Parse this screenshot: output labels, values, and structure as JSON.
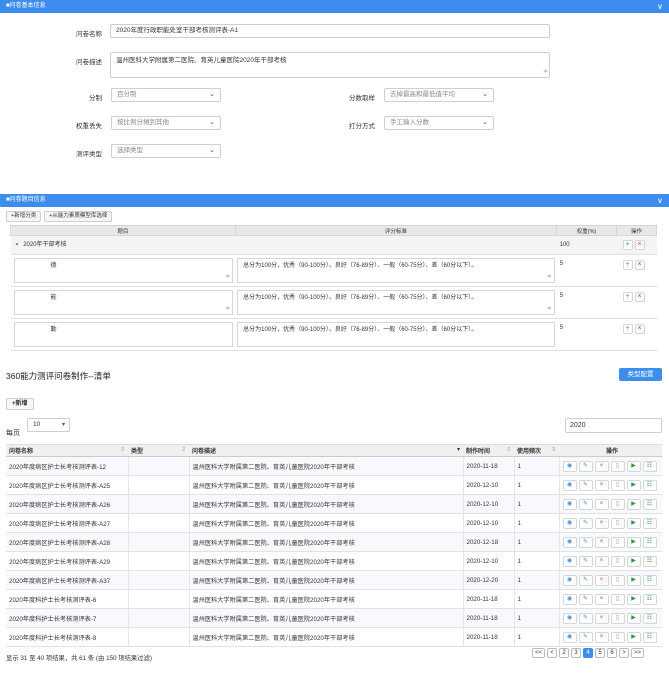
{
  "basic": {
    "header": "■问卷基本信息",
    "name_label": "问卷名称",
    "name_value": "2020年度行政职能处室干部考核测评表-A1",
    "desc_label": "问卷描述",
    "desc_value": "温州医科大学附属第二医院、育英儿童医院2020年干部考核",
    "scale_label": "分制",
    "scale_value": "百分制",
    "score_pick_label": "分数取样",
    "score_pick_value": "去掉最高和最低值平均",
    "weight_lost_label": "权重丢失",
    "weight_lost_value": "按比例分摊到其他",
    "scoring_label": "打分方式",
    "scoring_value": "手工输入分数",
    "type_label": "测评类型",
    "type_value": "选择类型"
  },
  "questions": {
    "header": "■问卷题目信息",
    "add_category": "+新增分类",
    "add_from_model": "+从能力素质模型库选择",
    "col_item": "题目",
    "col_criteria": "评分标准",
    "col_weight": "权重(%)",
    "col_ops": "操作",
    "group": {
      "name": "2020年干部考核",
      "weight": "100"
    },
    "rows": [
      {
        "item": "德",
        "criteria": "总分为100分，优秀（90-100分）、良好（76-89分）、一般（60-75分）、差（60分以下）。",
        "weight": "5"
      },
      {
        "item": "能",
        "criteria": "总分为100分，优秀（90-100分）、良好（76-89分）、一般（60-75分）、差（60分以下）。",
        "weight": "5"
      },
      {
        "item": "勤",
        "criteria": "总分为100分，优秀（90-100分）、良好（76-89分）、一般（60-75分）、差（60分以下）。",
        "weight": "5"
      }
    ]
  },
  "list": {
    "title": "360能力测评问卷制作--清单",
    "config_button": "类型配置",
    "add_button": "+新增",
    "per_page_value": "10",
    "per_page_label": "每页",
    "search_value": "2020",
    "columns": [
      "问卷名称",
      "类型",
      "问卷描述",
      "制作时间",
      "使用频次",
      "操作"
    ],
    "rows": [
      {
        "name": "2020年度病区护士长考核测评表-12",
        "type": "",
        "desc": "温州医科大学附属第二医院、育英儿童医院2020年干部考核",
        "date": "2020-11-18",
        "freq": "1"
      },
      {
        "name": "2020年度病区护士长考核测评表-A25",
        "type": "",
        "desc": "温州医科大学附属第二医院、育英儿童医院2020年干部考核",
        "date": "2020-12-10",
        "freq": "1"
      },
      {
        "name": "2020年度病区护士长考核测评表-A26",
        "type": "",
        "desc": "温州医科大学附属第二医院、育英儿童医院2020年干部考核",
        "date": "2020-12-10",
        "freq": "1"
      },
      {
        "name": "2020年度病区护士长考核测评表-A27",
        "type": "",
        "desc": "温州医科大学附属第二医院、育英儿童医院2020年干部考核",
        "date": "2020-12-10",
        "freq": "1"
      },
      {
        "name": "2020年度病区护士长考核测评表-A28",
        "type": "",
        "desc": "温州医科大学附属第二医院、育英儿童医院2020年干部考核",
        "date": "2020-12-18",
        "freq": "1"
      },
      {
        "name": "2020年度病区护士长考核测评表-A29",
        "type": "",
        "desc": "温州医科大学附属第二医院、育英儿童医院2020年干部考核",
        "date": "2020-12-10",
        "freq": "1"
      },
      {
        "name": "2020年度病区护士长考核测评表-A37",
        "type": "",
        "desc": "温州医科大学附属第二医院、育英儿童医院2020年干部考核",
        "date": "2020-12-20",
        "freq": "1"
      },
      {
        "name": "2020年度科护士长考核测评表-6",
        "type": "",
        "desc": "温州医科大学附属第二医院、育英儿童医院2020年干部考核",
        "date": "2020-11-18",
        "freq": "1"
      },
      {
        "name": "2020年度科护士长考核测评表-7",
        "type": "",
        "desc": "温州医科大学附属第二医院、育英儿童医院2020年干部考核",
        "date": "2020-11-18",
        "freq": "1"
      },
      {
        "name": "2020年度科护士长考核测评表-8",
        "type": "",
        "desc": "温州医科大学附属第二医院、育英儿童医院2020年干部考核",
        "date": "2020-11-18",
        "freq": "1"
      }
    ],
    "footer": "显示 31 至 40 项结果，共 61 条 (由 150 项结果过滤)",
    "pager": [
      "<<",
      "<",
      "2",
      "3",
      "4",
      "5",
      "6",
      ">",
      ">>"
    ],
    "active_page": "4"
  },
  "colors": {
    "accent": "#3c8dee",
    "danger": "#e03a3a",
    "success": "#2b9a3c"
  }
}
